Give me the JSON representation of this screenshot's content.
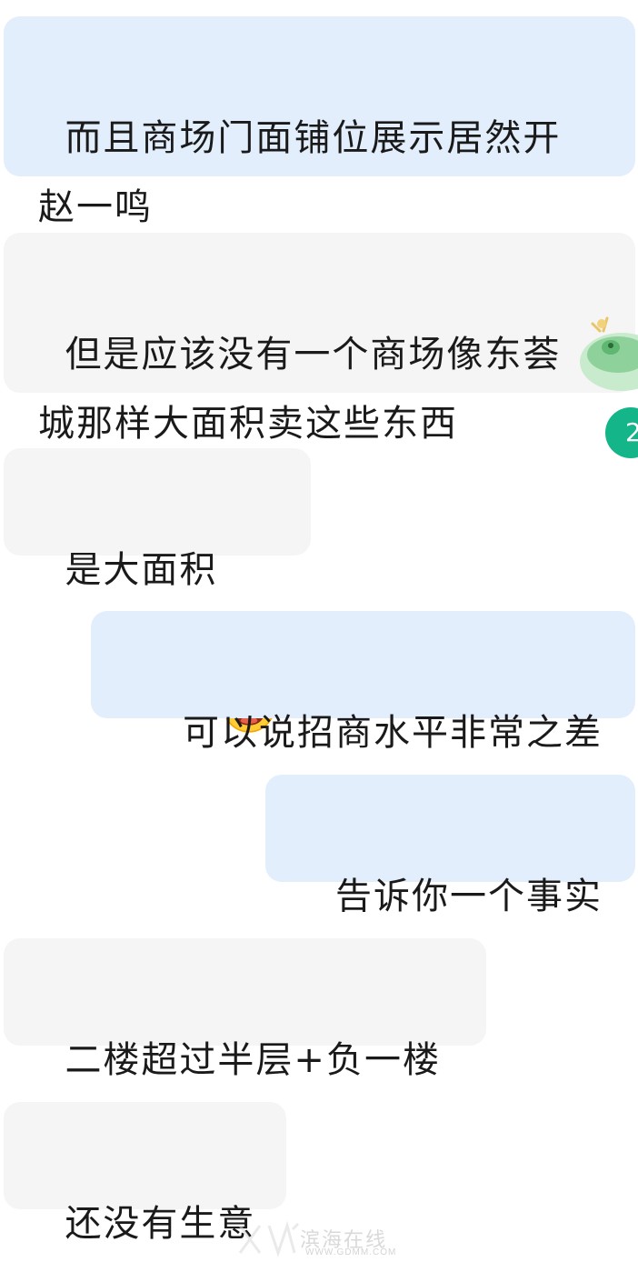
{
  "messages": [
    {
      "side": "mine",
      "text": "而且商场门面铺位展示居然开\n赵一鸣"
    },
    {
      "side": "theirs",
      "text": "但是应该没有一个商场像东荟\n城那样大面积卖这些东西"
    },
    {
      "side": "theirs",
      "text": "是大面积",
      "emoji": "tears-of-joy-emoji"
    },
    {
      "side": "mine",
      "text": "可以说招商水平非常之差"
    },
    {
      "side": "mine",
      "text": "告诉你一个事实"
    },
    {
      "side": "theirs",
      "text": "二楼超过半层+负一楼"
    },
    {
      "side": "theirs",
      "text": "还没有生意"
    }
  ],
  "badge": {
    "count": "2"
  },
  "watermark": {
    "text": "滨海在线",
    "url": "WWW.GDMM.COM"
  },
  "colors": {
    "mine_bubble": "#e3eefc",
    "theirs_bubble": "#f5f5f5",
    "badge": "#15b58a"
  },
  "icons": [
    "tears-of-joy-emoji",
    "frog-widget-icon",
    "watermark-logo"
  ]
}
